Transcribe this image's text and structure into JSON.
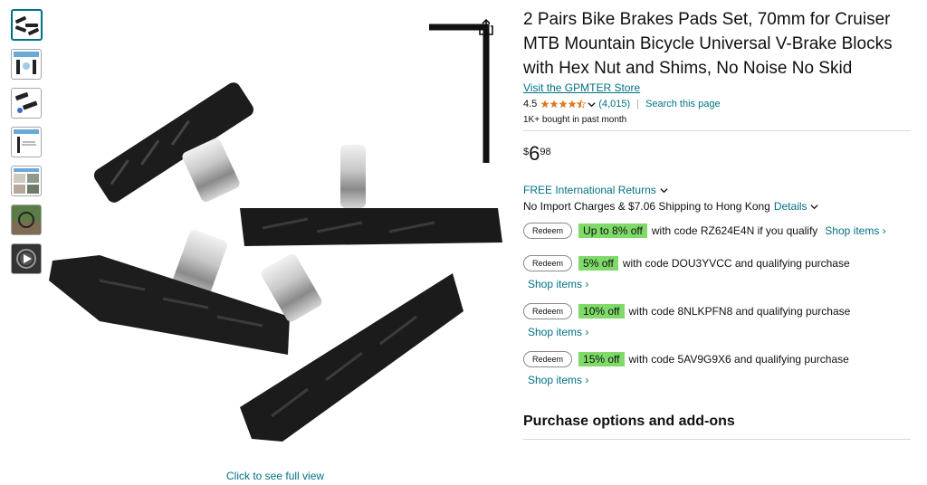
{
  "thumbnails": [
    {
      "name": "thumb-1",
      "active": true
    },
    {
      "name": "thumb-2",
      "active": false
    },
    {
      "name": "thumb-3",
      "active": false
    },
    {
      "name": "thumb-4",
      "active": false
    },
    {
      "name": "thumb-5",
      "active": false
    },
    {
      "name": "thumb-6",
      "active": false
    },
    {
      "name": "thumb-video",
      "active": false
    }
  ],
  "image": {
    "click_full_view": "Click to see full view",
    "share_icon": "share-icon"
  },
  "product": {
    "title": "2 Pairs Bike Brakes Pads Set, 70mm for Cruiser MTB Mountain Bicycle Universal V-Brake Blocks with Hex Nut and Shims, No Noise No Skid",
    "store_link": "Visit the GPMTER Store",
    "rating": "4.5",
    "stars": 4.5,
    "reviews": "(4,015)",
    "search_page": "Search this page",
    "bought": "1K+ bought in past month",
    "price": {
      "symbol": "$",
      "whole": "6",
      "fraction": "98"
    },
    "returns": "FREE International Returns",
    "shipping_text": "No Import Charges & $7.06 Shipping to Hong Kong",
    "shipping_details": "Details"
  },
  "coupons": [
    {
      "redeem": "Redeem",
      "badge": "Up to 8% off",
      "text": "with code RZ624E4N if you qualify",
      "shop": "Shop items ›"
    },
    {
      "redeem": "Redeem",
      "badge": "5% off",
      "text": "with code DOU3YVCC and qualifying purchase",
      "shop": "Shop items ›"
    },
    {
      "redeem": "Redeem",
      "badge": "10% off",
      "text": "with code 8NLKPFN8 and qualifying purchase",
      "shop": "Shop items ›"
    },
    {
      "redeem": "Redeem",
      "badge": "15% off",
      "text": "with code 5AV9G9X6 and qualifying purchase",
      "shop": "Shop items ›"
    }
  ],
  "purchase_options": "Purchase options and add-ons",
  "colors": {
    "link": "#007185",
    "badge": "#7fda69",
    "star": "#de7921"
  }
}
